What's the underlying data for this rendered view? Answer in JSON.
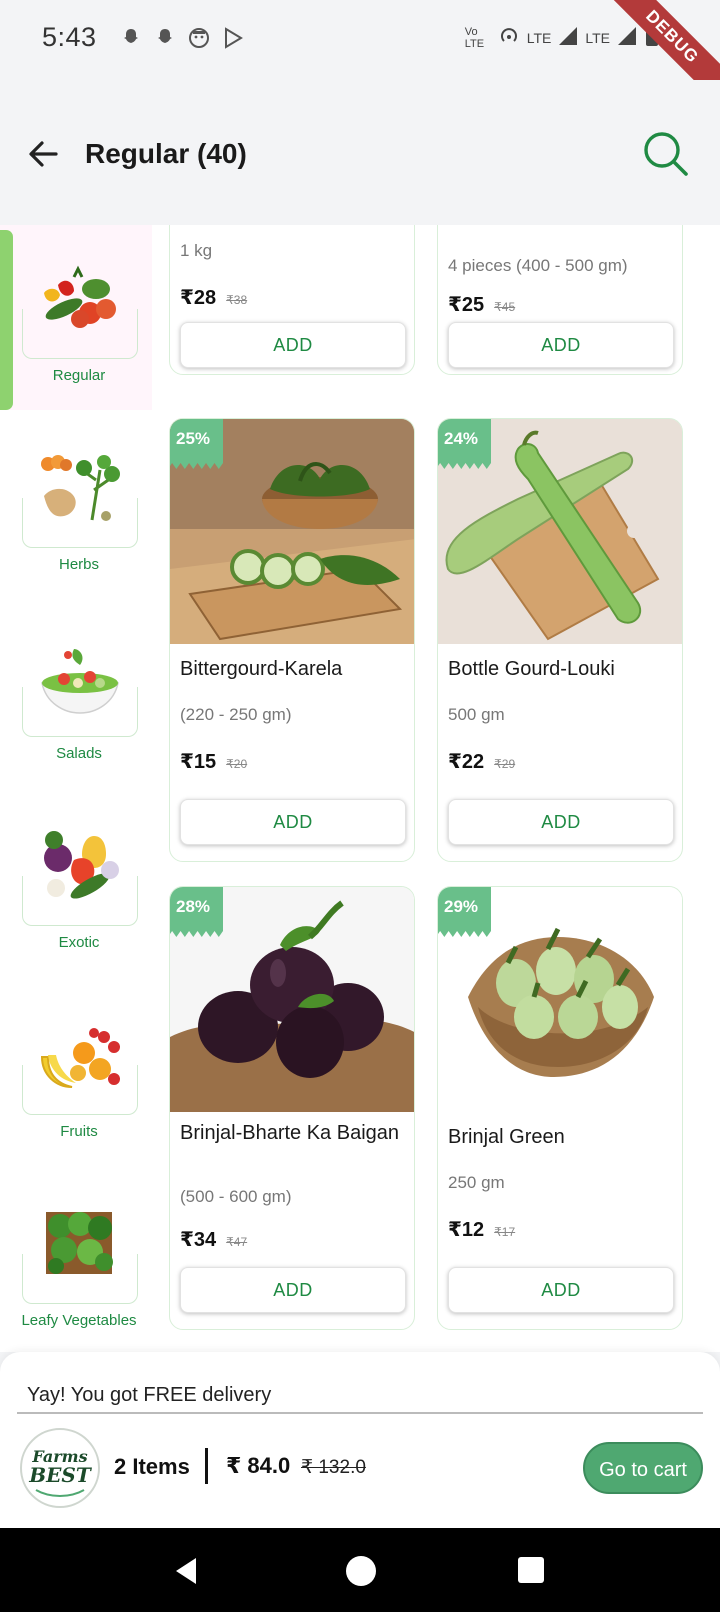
{
  "status_bar": {
    "time": "5:43",
    "left_icons": [
      "snapchat-icon",
      "snapchat-icon",
      "face-icon",
      "play-store-icon"
    ],
    "right_icons": [
      "volte-icon",
      "hotspot-icon",
      "lte-signal-icon",
      "lte-signal-icon",
      "battery-icon"
    ],
    "network_labels": [
      "Vo LTE",
      "LTE",
      "LTE"
    ],
    "debug_label": "DEBUG"
  },
  "header": {
    "title": "Regular (40)",
    "back_icon": "arrow-left-icon",
    "search_icon": "search-icon",
    "accent_color": "#1f8a43"
  },
  "sidebar": {
    "items": [
      {
        "label": "Regular",
        "active": true
      },
      {
        "label": "Herbs",
        "active": false
      },
      {
        "label": "Salads",
        "active": false
      },
      {
        "label": "Exotic",
        "active": false
      },
      {
        "label": "Fruits",
        "active": false
      },
      {
        "label": "Leafy Vegetables",
        "active": false
      }
    ]
  },
  "products": [
    {
      "name": "",
      "qty": "1 kg",
      "price": "₹28",
      "mrp": "₹38",
      "add_label": "ADD"
    },
    {
      "name": "",
      "qty": "4 pieces (400 - 500 gm)",
      "price": "₹25",
      "mrp": "₹45",
      "add_label": "ADD"
    },
    {
      "name": "Bittergourd-Karela",
      "qty": "(220 - 250 gm)",
      "price": "₹15",
      "mrp": "₹20",
      "discount": "25%",
      "add_label": "ADD"
    },
    {
      "name": "Bottle Gourd-Louki",
      "qty": "500 gm",
      "price": "₹22",
      "mrp": "₹29",
      "discount": "24%",
      "add_label": "ADD"
    },
    {
      "name": "Brinjal-Bharte Ka Baigan",
      "qty": "(500 - 600 gm)",
      "price": "₹34",
      "mrp": "₹47",
      "discount": "28%",
      "add_label": "ADD"
    },
    {
      "name": "Brinjal Green",
      "qty": "250 gm",
      "price": "₹12",
      "mrp": "₹17",
      "discount": "29%",
      "add_label": "ADD"
    }
  ],
  "cart": {
    "free_delivery": "Yay! You got FREE delivery",
    "items_count": "2 Items",
    "total": "₹ 84.0",
    "mrp_total": "₹ 132.0",
    "button_label": "Go to cart",
    "brand_text": "Farms BEST"
  },
  "colors": {
    "green": "#1f8a43",
    "badge": "#69bf8a",
    "active_bar": "#8ed26f",
    "cart_button": "#4fa871"
  }
}
